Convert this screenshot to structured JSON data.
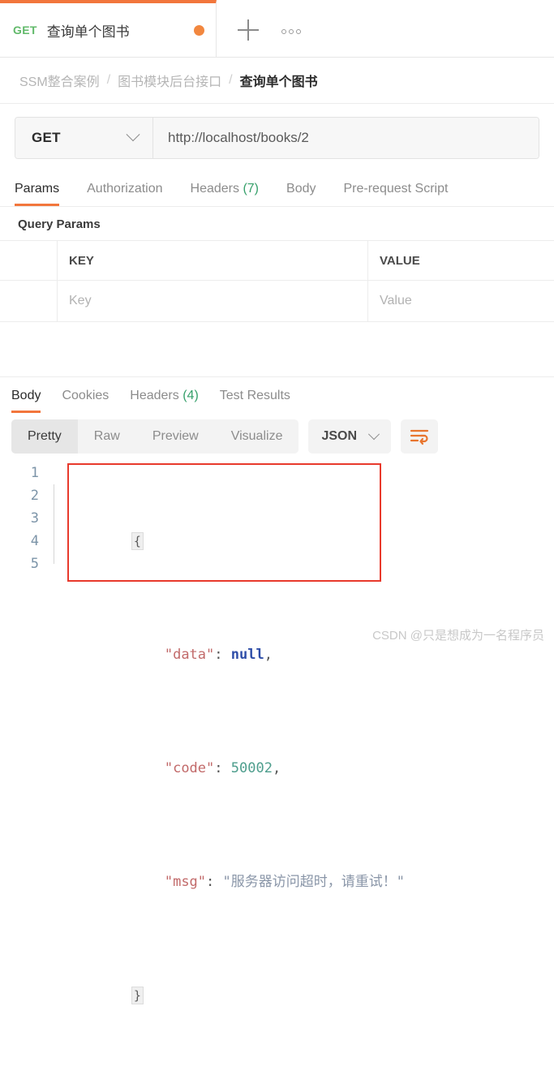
{
  "tabbar": {
    "tab": {
      "method": "GET",
      "title": "查询单个图书",
      "unsaved_dot": "●"
    },
    "new_tab_label": "+",
    "more_label": "ooo"
  },
  "breadcrumb": {
    "items": [
      "SSM整合案例",
      "图书模块后台接口",
      "查询单个图书"
    ],
    "separator": "/"
  },
  "request": {
    "method": "GET",
    "url": "http://localhost/books/2",
    "tabs": [
      {
        "label": "Params",
        "count": ""
      },
      {
        "label": "Authorization",
        "count": ""
      },
      {
        "label": "Headers",
        "count": "(7)"
      },
      {
        "label": "Body",
        "count": ""
      },
      {
        "label": "Pre-request Script",
        "count": ""
      }
    ],
    "params": {
      "section_title": "Query Params",
      "columns": [
        "KEY",
        "VALUE"
      ],
      "rows": [
        {
          "key": "Key",
          "value": "Value"
        }
      ]
    }
  },
  "response": {
    "tabs": [
      {
        "label": "Body",
        "count": ""
      },
      {
        "label": "Cookies",
        "count": ""
      },
      {
        "label": "Headers",
        "count": "(4)"
      },
      {
        "label": "Test Results",
        "count": ""
      }
    ],
    "format_modes": [
      "Pretty",
      "Raw",
      "Preview",
      "Visualize"
    ],
    "active_format": "Pretty",
    "language": "JSON",
    "wrap_icon": "wrap-text-icon",
    "body": {
      "line_numbers": [
        "1",
        "2",
        "3",
        "4",
        "5"
      ],
      "open_brace": "{",
      "close_brace": "}",
      "lines": [
        {
          "key": "\"data\"",
          "colon": ": ",
          "value": "null",
          "value_type": "null",
          "comma": ","
        },
        {
          "key": "\"code\"",
          "colon": ": ",
          "value": "50002",
          "value_type": "number",
          "comma": ","
        },
        {
          "key": "\"msg\"",
          "colon": ": ",
          "value": "\"服务器访问超时，请重试！\"",
          "value_type": "string",
          "comma": ""
        }
      ]
    }
  },
  "watermark": "CSDN @只是想成为一名程序员",
  "colors": {
    "accent_orange": "#f2763c",
    "method_green": "#61b96a",
    "count_green": "#37a06b",
    "annotation_red": "#e8392c",
    "json_key": "#c26a6a",
    "json_null": "#2f4ea8",
    "json_number": "#4e9e8d",
    "json_string": "#8a96a8"
  }
}
